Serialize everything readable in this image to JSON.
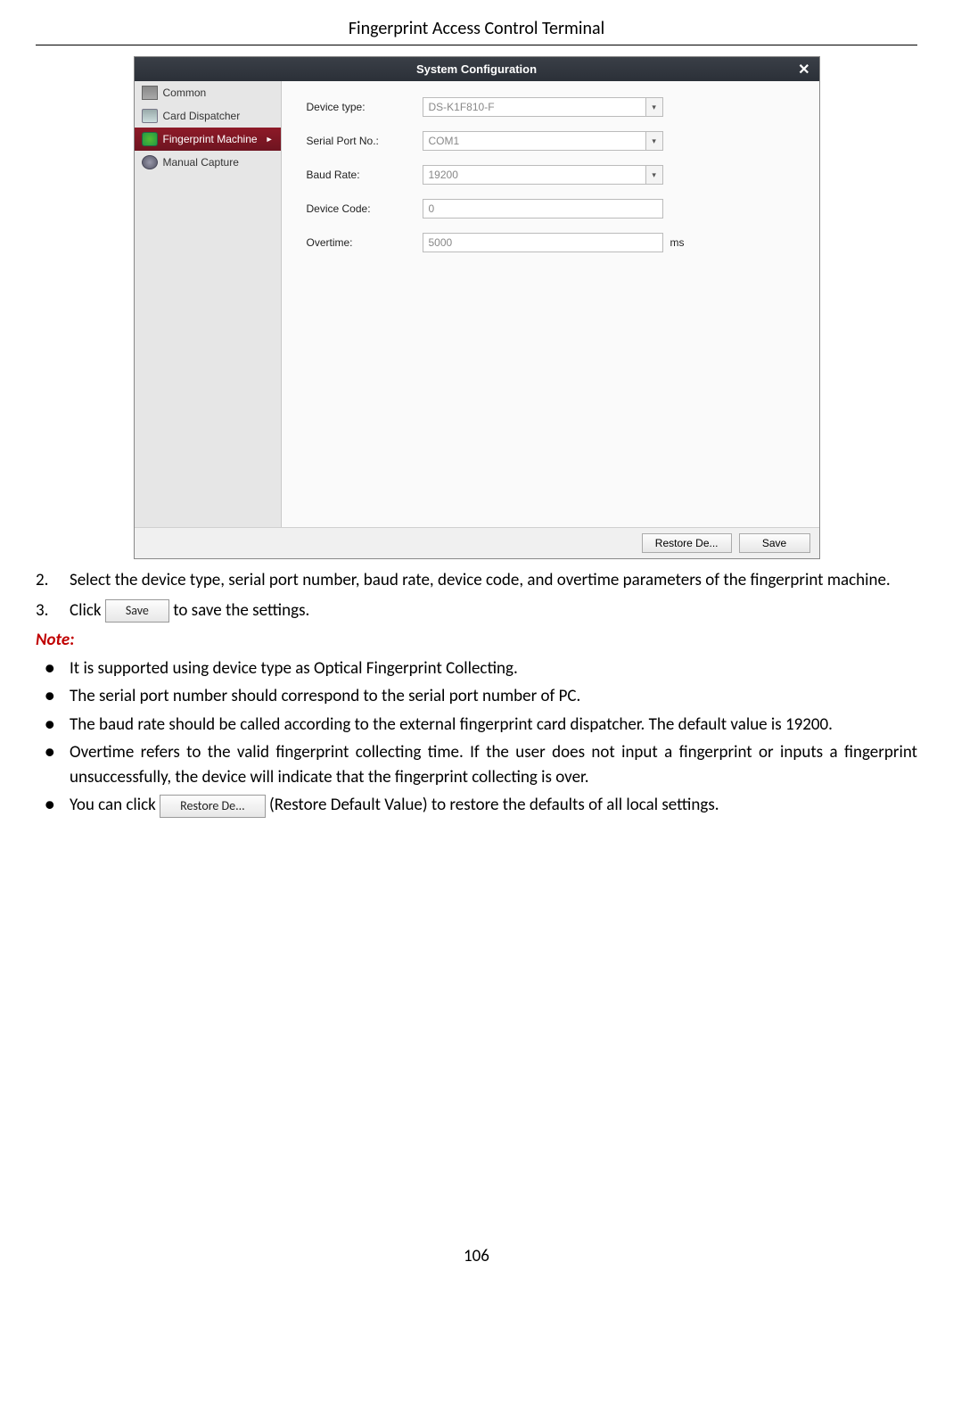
{
  "header": {
    "title": "Fingerprint Access Control Terminal"
  },
  "window": {
    "title": "System Configuration",
    "close_glyph": "✕",
    "sidebar": {
      "items": [
        {
          "label": "Common"
        },
        {
          "label": "Card Dispatcher"
        },
        {
          "label": "Fingerprint Machine"
        },
        {
          "label": "Manual Capture"
        }
      ]
    },
    "form": {
      "device_type": {
        "label": "Device type:",
        "value": "DS-K1F810-F"
      },
      "serial_port": {
        "label": "Serial Port No.:",
        "value": "COM1"
      },
      "baud_rate": {
        "label": "Baud Rate:",
        "value": "19200"
      },
      "device_code": {
        "label": "Device Code:",
        "value": "0"
      },
      "overtime": {
        "label": "Overtime:",
        "value": "5000",
        "suffix": "ms"
      }
    },
    "footer": {
      "restore_label": "Restore De...",
      "save_label": "Save"
    }
  },
  "doc": {
    "step2_num": "2.",
    "step2": "Select the device type, serial port number, baud rate, device code, and overtime parameters of the fingerprint machine.",
    "step3_num": "3.",
    "step3_before": "Click ",
    "step3_btn": "Save",
    "step3_after": " to save the settings.",
    "note_label": "Note:",
    "bullets": [
      "It is supported using device type as Optical Fingerprint Collecting.",
      "The serial port number should correspond to the serial port number of PC.",
      "The baud rate should be called according to the external fingerprint card dispatcher. The default value is 19200.",
      "Overtime refers to the valid fingerprint collecting time. If the user does not input a fingerprint or inputs a fingerprint unsuccessfully, the device will indicate that the fingerprint collecting is over."
    ],
    "bullet5_before": "You can click ",
    "bullet5_btn": "Restore De...",
    "bullet5_after": " (Restore Default Value) to restore the defaults of all local settings."
  },
  "page_number": "106"
}
